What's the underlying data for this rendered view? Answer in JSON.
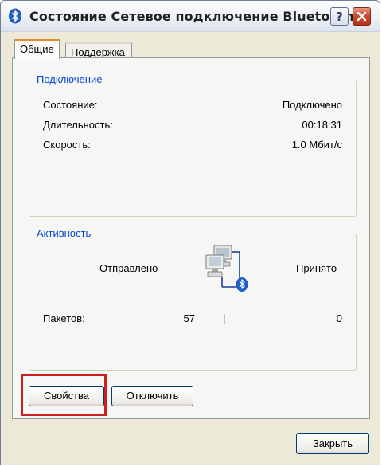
{
  "window": {
    "title": "Состояние Сетевое подключение Bluetooth",
    "help_label": "?",
    "icons": {
      "title": "bluetooth-icon",
      "help": "help-icon",
      "close": "close-icon",
      "network": "network-computers-icon"
    }
  },
  "tabs": [
    {
      "label": "Общие",
      "active": true
    },
    {
      "label": "Поддержка",
      "active": false
    }
  ],
  "connection": {
    "legend": "Подключение",
    "rows": [
      {
        "label": "Состояние:",
        "value": "Подключено"
      },
      {
        "label": "Длительность:",
        "value": "00:18:31"
      },
      {
        "label": "Скорость:",
        "value": "1.0 Мбит/с"
      }
    ]
  },
  "activity": {
    "legend": "Активность",
    "sent_label": "Отправлено",
    "received_label": "Принято",
    "packets_label": "Пакетов:",
    "packets_sent": "57",
    "packets_received": "0",
    "separator": "|"
  },
  "buttons": {
    "properties": "Свойства",
    "disconnect": "Отключить",
    "close": "Закрыть"
  },
  "colors": {
    "legend_text": "#0046d5",
    "highlight": "#d01d1d",
    "close_button": "#c7482c",
    "active_tab_accent": "#e68b2c"
  }
}
